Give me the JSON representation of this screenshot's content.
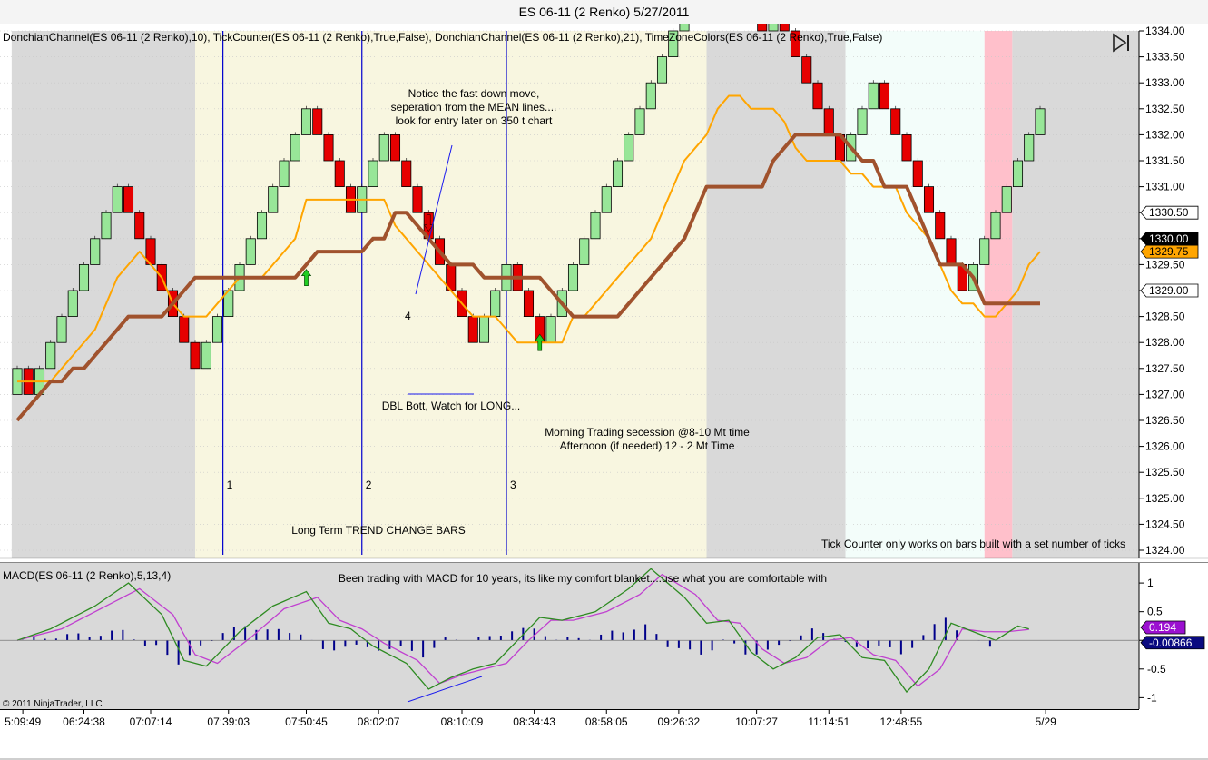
{
  "window_title": "ES 06-11 (2 Renko)  5/27/2011",
  "indicator_labels": {
    "price_panel": "DonchianChannel(ES 06-11  (2  Renko),10),  TickCounter(ES 06-11  (2  Renko),True,False),  DonchianChannel(ES 06-11  (2  Renko),21),  TimeZoneColors(ES  06-11  (2  Renko),True,False)",
    "macd_panel": "MACD(ES 06-11 (2 Renko),5,13,4)"
  },
  "annotations": {
    "fast_down_1": "Notice the fast down move,",
    "fast_down_2": "seperation from the MEAN lines....",
    "fast_down_3": "look for entry later on 350 t chart",
    "dbl_bott": "DBL Bott, Watch for LONG...",
    "morning": "Morning Trading secession @8-10 Mt time",
    "afternoon": "Afternoon (if needed) 12 - 2 Mt Time",
    "long_term": "Long Term TREND CHANGE BARS",
    "tick_counter": "Tick Counter only works on bars built with a set number of ticks",
    "macd_note": "Been trading with MACD for 10 years, its like my comfort blanket....use what you are comfortable with",
    "num_1": "1",
    "num_2": "2",
    "num_3": "3",
    "num_4": "4"
  },
  "copyright": "© 2011 NinjaTrader, LLC",
  "colors": {
    "up_bar": "#98e698",
    "down_bar": "#e60000",
    "donchian_10": "#ffa500",
    "donchian_21": "#a0522d",
    "macd_line": "#2e8b22",
    "macd_signal": "#c040d0",
    "macd_hist": "#00008b",
    "zone_grey": "#d9d9d9",
    "zone_cream": "#f8f6e0",
    "zone_mint": "#f3fdfa",
    "zone_pink": "#ffc0cb",
    "vertical_marker": "#0000cd"
  },
  "chart_data": [
    {
      "type": "renko",
      "brick_size": 0.5,
      "ylim": [
        1324.0,
        1334.0
      ],
      "y_ticks": [
        1324.0,
        1324.5,
        1325.0,
        1325.5,
        1326.0,
        1326.5,
        1327.0,
        1327.5,
        1328.0,
        1328.5,
        1329.0,
        1329.5,
        1330.0,
        1330.5,
        1331.0,
        1331.5,
        1332.0,
        1332.5,
        1333.0,
        1333.5,
        1334.0
      ],
      "y_tick_labels": [
        "1324.00",
        "1324.50",
        "1325.00",
        "1325.50",
        "1326.00",
        "1326.50",
        "1327.00",
        "1327.50",
        "1328.00",
        "1328.50",
        "1329.00",
        "1329.50",
        "1330.00",
        "1330.50",
        "1331.00",
        "1331.50",
        "1332.00",
        "1332.50",
        "1333.00",
        "1333.50",
        "1334.00"
      ],
      "bar_count": 93,
      "start_low": 1327.0,
      "directions": [
        "u",
        "d",
        "u",
        "u",
        "u",
        "u",
        "u",
        "u",
        "u",
        "u",
        "d",
        "d",
        "d",
        "d",
        "d",
        "d",
        "d",
        "u",
        "u",
        "u",
        "u",
        "u",
        "u",
        "u",
        "u",
        "u",
        "u",
        "d",
        "d",
        "d",
        "d",
        "u",
        "u",
        "u",
        "d",
        "d",
        "d",
        "d",
        "d",
        "d",
        "d",
        "d",
        "u",
        "u",
        "u",
        "d",
        "d",
        "d",
        "u",
        "u",
        "u",
        "u",
        "u",
        "u",
        "u",
        "u",
        "u",
        "u",
        "u",
        "u",
        "u",
        "u",
        "u",
        "d",
        "u",
        "d",
        "d",
        "d",
        "u",
        "d",
        "d",
        "d",
        "d",
        "d",
        "d",
        "u",
        "u",
        "u",
        "d",
        "d",
        "d",
        "d",
        "d",
        "d",
        "d",
        "d",
        "u",
        "u",
        "u",
        "u",
        "u",
        "u",
        "u"
      ],
      "value_labels": [
        {
          "value": 1330.5,
          "text": "1330.50",
          "style": "white"
        },
        {
          "value": 1330.0,
          "text": "1330.00",
          "style": "black"
        },
        {
          "value": 1329.75,
          "text": "1329.75",
          "style": "orange"
        },
        {
          "value": 1329.0,
          "text": "1329.00",
          "style": "white"
        }
      ],
      "donchian_10": [
        1327.25,
        1327.25,
        1327.25,
        1327.25,
        1327.5,
        1327.75,
        1328.0,
        1328.25,
        1328.75,
        1329.25,
        1329.5,
        1329.75,
        1329.5,
        1329.25,
        1328.75,
        1328.5,
        1328.5,
        1328.5,
        1328.75,
        1329.0,
        1329.25,
        1329.25,
        1329.25,
        1329.5,
        1329.75,
        1330.0,
        1330.75,
        1330.75,
        1330.75,
        1330.75,
        1330.75,
        1330.75,
        1330.75,
        1330.75,
        1330.25,
        1330.0,
        1329.75,
        1329.5,
        1329.25,
        1329.0,
        1328.75,
        1328.5,
        1328.5,
        1328.5,
        1328.25,
        1328.0,
        1328.0,
        1328.0,
        1328.0,
        1328.0,
        1328.5,
        1328.5,
        1328.75,
        1329.0,
        1329.25,
        1329.5,
        1329.75,
        1330.0,
        1330.5,
        1331.0,
        1331.5,
        1331.75,
        1332.0,
        1332.5,
        1332.75,
        1332.75,
        1332.5,
        1332.5,
        1332.5,
        1332.25,
        1331.75,
        1331.5,
        1331.5,
        1331.5,
        1331.5,
        1331.25,
        1331.25,
        1331.0,
        1331.0,
        1331.0,
        1330.5,
        1330.25,
        1330.0,
        1329.5,
        1329.0,
        1328.75,
        1328.75,
        1328.5,
        1328.5,
        1328.75,
        1329.0,
        1329.5,
        1329.75
      ],
      "donchian_21": [
        1326.5,
        1326.75,
        1327.0,
        1327.25,
        1327.25,
        1327.5,
        1327.5,
        1327.75,
        1328.0,
        1328.25,
        1328.5,
        1328.5,
        1328.5,
        1328.5,
        1328.75,
        1329.0,
        1329.25,
        1329.25,
        1329.25,
        1329.25,
        1329.25,
        1329.25,
        1329.25,
        1329.25,
        1329.25,
        1329.25,
        1329.5,
        1329.75,
        1329.75,
        1329.75,
        1329.75,
        1329.75,
        1330.0,
        1330.0,
        1330.5,
        1330.5,
        1330.25,
        1330.0,
        1329.75,
        1329.5,
        1329.5,
        1329.5,
        1329.25,
        1329.25,
        1329.25,
        1329.25,
        1329.25,
        1329.25,
        1329.0,
        1328.75,
        1328.5,
        1328.5,
        1328.5,
        1328.5,
        1328.5,
        1328.75,
        1329.0,
        1329.25,
        1329.5,
        1329.75,
        1330.0,
        1330.5,
        1331.0,
        1331.0,
        1331.0,
        1331.0,
        1331.0,
        1331.0,
        1331.5,
        1331.75,
        1332.0,
        1332.0,
        1332.0,
        1332.0,
        1332.0,
        1331.75,
        1331.5,
        1331.5,
        1331.0,
        1331.0,
        1331.0,
        1330.5,
        1330.0,
        1329.5,
        1329.5,
        1329.5,
        1329.25,
        1328.75,
        1328.75,
        1328.75,
        1328.75,
        1328.75,
        1328.75
      ],
      "session_zones": [
        {
          "from_bar": 0,
          "to_bar": 16.5,
          "zone": "zone_grey"
        },
        {
          "from_bar": 16.5,
          "to_bar": 62.5,
          "zone": "zone_cream"
        },
        {
          "from_bar": 62.5,
          "to_bar": 75,
          "zone": "zone_grey"
        },
        {
          "from_bar": 75,
          "to_bar": 87.5,
          "zone": "zone_mint"
        },
        {
          "from_bar": 87.5,
          "to_bar": 90,
          "zone": "zone_pink"
        },
        {
          "from_bar": 90,
          "to_bar": 112,
          "zone": "zone_grey"
        }
      ],
      "vertical_markers": [
        {
          "bar": 19,
          "label": "1"
        },
        {
          "bar": 31.5,
          "label": "2"
        },
        {
          "bar": 44.5,
          "label": "3"
        }
      ],
      "signal_arrows": [
        {
          "bar": 26,
          "value": 1329.25,
          "dir": "up"
        },
        {
          "bar": 37,
          "value": 1330.3,
          "dir": "down"
        },
        {
          "bar": 47,
          "value": 1328.0,
          "dir": "up"
        }
      ]
    },
    {
      "type": "macd",
      "ylim": [
        -1.2,
        1.35
      ],
      "y_ticks": [
        1,
        0.5,
        0,
        -0.5,
        -1
      ],
      "y_tick_labels": [
        "1",
        "0.5",
        "",
        "-0.5",
        "-1"
      ],
      "value_labels": [
        {
          "value": 0.194,
          "text": "0.194",
          "style": "purple"
        },
        {
          "value": -0.00866,
          "text": "-0.00866",
          "style": "navy"
        }
      ],
      "macd_keypoints": [
        [
          0,
          0.0
        ],
        [
          3,
          0.2
        ],
        [
          7,
          0.6
        ],
        [
          10,
          1.0
        ],
        [
          13,
          0.45
        ],
        [
          15,
          -0.35
        ],
        [
          17,
          -0.45
        ],
        [
          20,
          0.15
        ],
        [
          23,
          0.6
        ],
        [
          26,
          0.85
        ],
        [
          28,
          0.3
        ],
        [
          30,
          0.2
        ],
        [
          32,
          -0.1
        ],
        [
          35,
          -0.4
        ],
        [
          37,
          -0.85
        ],
        [
          39,
          -0.65
        ],
        [
          41,
          -0.5
        ],
        [
          43,
          -0.4
        ],
        [
          45,
          0.0
        ],
        [
          47,
          0.4
        ],
        [
          49,
          0.35
        ],
        [
          52,
          0.5
        ],
        [
          55,
          0.9
        ],
        [
          57,
          1.25
        ],
        [
          60,
          0.75
        ],
        [
          62,
          0.3
        ],
        [
          64,
          0.35
        ],
        [
          66,
          -0.2
        ],
        [
          68,
          -0.5
        ],
        [
          70,
          -0.3
        ],
        [
          72,
          0.05
        ],
        [
          74,
          0.1
        ],
        [
          76,
          -0.3
        ],
        [
          78,
          -0.35
        ],
        [
          80,
          -0.9
        ],
        [
          82,
          -0.5
        ],
        [
          84,
          0.3
        ],
        [
          86,
          0.15
        ],
        [
          88,
          0.0
        ],
        [
          90,
          0.25
        ],
        [
          91,
          0.2
        ]
      ],
      "signal_keypoints": [
        [
          0,
          0.0
        ],
        [
          4,
          0.2
        ],
        [
          8,
          0.6
        ],
        [
          11,
          0.9
        ],
        [
          14,
          0.45
        ],
        [
          16,
          -0.25
        ],
        [
          18,
          -0.4
        ],
        [
          21,
          0.05
        ],
        [
          24,
          0.55
        ],
        [
          27,
          0.75
        ],
        [
          29,
          0.35
        ],
        [
          31,
          0.2
        ],
        [
          33,
          -0.05
        ],
        [
          36,
          -0.35
        ],
        [
          38,
          -0.75
        ],
        [
          40,
          -0.6
        ],
        [
          42,
          -0.5
        ],
        [
          44,
          -0.4
        ],
        [
          46,
          0.0
        ],
        [
          48,
          0.35
        ],
        [
          50,
          0.35
        ],
        [
          53,
          0.5
        ],
        [
          56,
          0.8
        ],
        [
          58,
          1.15
        ],
        [
          61,
          0.8
        ],
        [
          63,
          0.35
        ],
        [
          65,
          0.3
        ],
        [
          67,
          -0.15
        ],
        [
          69,
          -0.4
        ],
        [
          71,
          -0.3
        ],
        [
          73,
          0.0
        ],
        [
          75,
          0.05
        ],
        [
          77,
          -0.25
        ],
        [
          79,
          -0.35
        ],
        [
          81,
          -0.8
        ],
        [
          83,
          -0.5
        ],
        [
          85,
          0.2
        ],
        [
          87,
          0.15
        ],
        [
          89,
          0.15
        ],
        [
          91,
          0.19
        ]
      ],
      "histogram_bars": 88
    }
  ],
  "x_axis_labels": [
    {
      "bar": 0.5,
      "text": "5:09:49"
    },
    {
      "bar": 6,
      "text": "06:24:38"
    },
    {
      "bar": 12,
      "text": "07:07:14"
    },
    {
      "bar": 19,
      "text": "07:39:03"
    },
    {
      "bar": 26,
      "text": "07:50:45"
    },
    {
      "bar": 32.5,
      "text": "08:02:07"
    },
    {
      "bar": 40,
      "text": "08:10:09"
    },
    {
      "bar": 46.5,
      "text": "08:34:43"
    },
    {
      "bar": 53,
      "text": "08:58:05"
    },
    {
      "bar": 59.5,
      "text": "09:26:32"
    },
    {
      "bar": 66.5,
      "text": "10:07:27"
    },
    {
      "bar": 73,
      "text": "11:14:51"
    },
    {
      "bar": 79.5,
      "text": "12:48:55"
    },
    {
      "bar": 92.5,
      "text": "5/29"
    }
  ]
}
